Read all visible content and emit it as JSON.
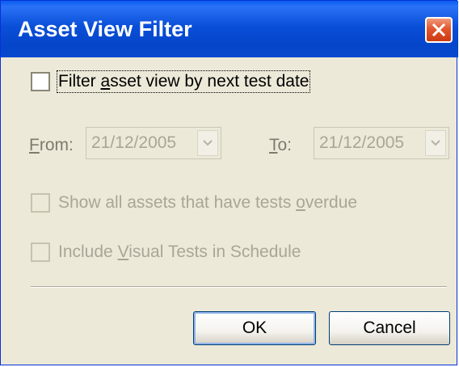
{
  "window": {
    "title": "Asset View Filter"
  },
  "filter_checkbox": {
    "checked": false,
    "label_before": "Filter ",
    "label_mnemonic": "a",
    "label_after": "sset view by next test date"
  },
  "date_range": {
    "from_label_mnemonic": "F",
    "from_label_rest": "rom:",
    "from_value": "21/12/2005",
    "to_label_mnemonic": "T",
    "to_label_rest": "o:",
    "to_value": "21/12/2005"
  },
  "overdue_checkbox": {
    "checked": false,
    "enabled": false,
    "label_before": "Show all assets that have tests ",
    "label_mnemonic": "o",
    "label_after": "verdue"
  },
  "visual_checkbox": {
    "checked": false,
    "enabled": false,
    "label_before": "Include ",
    "label_mnemonic": "V",
    "label_after": "isual Tests in Schedule"
  },
  "buttons": {
    "ok_label": "OK",
    "cancel_label": "Cancel"
  },
  "colors": {
    "titlebar": "#0a4fd8",
    "dialog_background": "#ece9d8",
    "close_button": "#e2572e",
    "disabled_text": "#a9a697"
  },
  "icons": {
    "close": "close-icon",
    "dropdown": "chevron-down-icon"
  }
}
